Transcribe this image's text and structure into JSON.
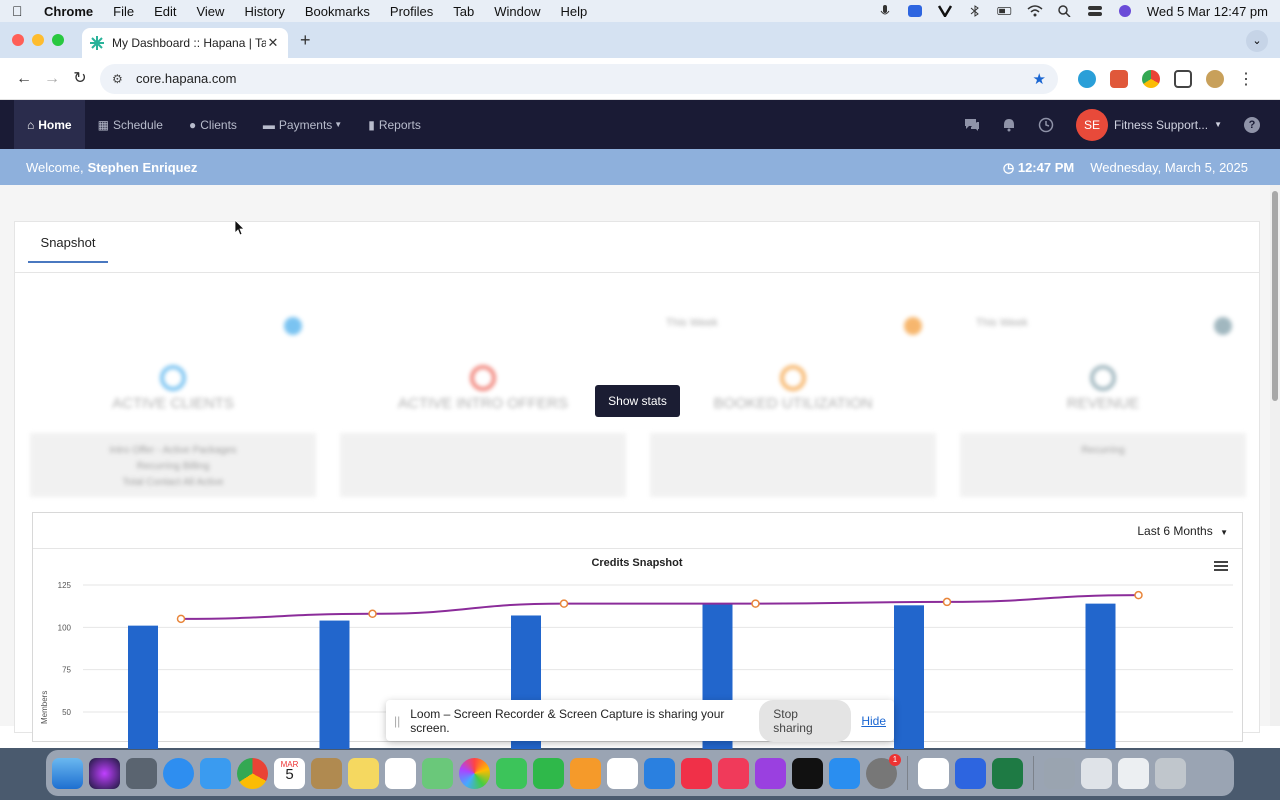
{
  "menubar": {
    "app": "Chrome",
    "items": [
      "File",
      "Edit",
      "View",
      "History",
      "Bookmarks",
      "Profiles",
      "Tab",
      "Window",
      "Help"
    ],
    "clock": "Wed 5 Mar  12:47 pm"
  },
  "browser": {
    "tab_title": "My Dashboard :: Hapana | Tak",
    "url": "core.hapana.com"
  },
  "nav": {
    "items": [
      {
        "label": "Home",
        "icon": "home-icon"
      },
      {
        "label": "Schedule",
        "icon": "calendar-icon"
      },
      {
        "label": "Clients",
        "icon": "user-icon"
      },
      {
        "label": "Payments",
        "icon": "card-icon"
      },
      {
        "label": "Reports",
        "icon": "bar-chart-icon"
      }
    ],
    "avatar_initials": "SE",
    "account_label": "Fitness Support...",
    "help": "?"
  },
  "welcome": {
    "prefix": "Welcome,",
    "name": "Stephen Enriquez",
    "time": "12:47 PM",
    "date": "Wednesday, March 5, 2025"
  },
  "snapshot_tab": "Snapshot",
  "stats": [
    {
      "label": "ACTIVE CLIENTS",
      "period": "",
      "footer": [
        "Intro Offer - Active Packages",
        "Recurring Billing",
        "Total Contact All Active"
      ],
      "color": "#5ab5ee"
    },
    {
      "label": "ACTIVE INTRO OFFERS",
      "period": "",
      "footer": [],
      "color": "#ee6a5e"
    },
    {
      "label": "BOOKED UTILIZATION",
      "period": "This Week",
      "footer": [],
      "color": "#f5a54a"
    },
    {
      "label": "REVENUE",
      "period": "This Week",
      "footer": [
        "Recurring"
      ],
      "color": "#8aa6b0"
    }
  ],
  "show_stats_button": "Show stats",
  "period_select": "Last 6 Months",
  "chart_data": {
    "type": "bar",
    "title": "Credits Snapshot",
    "ylabel": "Members",
    "yticks": [
      50,
      75,
      100,
      125
    ],
    "ylim": [
      45,
      125
    ],
    "categories": [
      "",
      "",
      "",
      "",
      "",
      ""
    ],
    "series": [
      {
        "type": "bar",
        "values": [
          101,
          104,
          107,
          114,
          113,
          114
        ],
        "color": "#2266cc"
      },
      {
        "type": "line",
        "values": [
          105,
          108,
          114,
          114,
          115,
          119
        ],
        "color": "#8b2c9a"
      }
    ]
  },
  "loom": {
    "message": "Loom – Screen Recorder & Screen Capture is sharing your screen.",
    "stop": "Stop sharing",
    "hide": "Hide"
  },
  "dock": {
    "calendar_month": "MAR",
    "calendar_day": "5"
  }
}
